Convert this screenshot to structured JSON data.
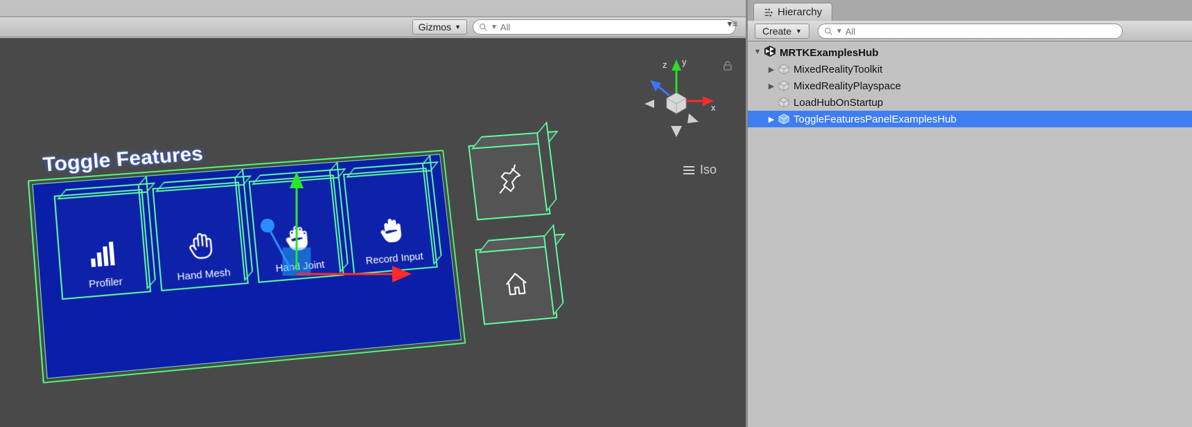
{
  "scene_toolbar": {
    "gizmos_label": "Gizmos",
    "search_placeholder": "All"
  },
  "viewport": {
    "projection_mode": "Iso",
    "axis": {
      "x": "x",
      "y": "y",
      "z": "z"
    }
  },
  "toggle_panel": {
    "title": "Toggle Features",
    "buttons": [
      {
        "label": "Profiler",
        "icon": "bars-icon"
      },
      {
        "label": "Hand Mesh",
        "icon": "hand-icon"
      },
      {
        "label": "Hand Joint",
        "icon": "hand-joint-icon"
      },
      {
        "label": "Record Input",
        "icon": "hand-record-icon"
      }
    ],
    "side_buttons": [
      {
        "icon": "pin-icon"
      },
      {
        "icon": "home-icon"
      }
    ]
  },
  "hierarchy_panel": {
    "tab_label": "Hierarchy",
    "create_label": "Create",
    "search_placeholder": "All",
    "scene_name": "MRTKExamplesHub",
    "items": [
      {
        "label": "MixedRealityToolkit",
        "has_children": true,
        "selected": false
      },
      {
        "label": "MixedRealityPlayspace",
        "has_children": true,
        "selected": false
      },
      {
        "label": "LoadHubOnStartup",
        "has_children": false,
        "selected": false
      },
      {
        "label": "ToggleFeaturesPanelExamplesHub",
        "has_children": true,
        "selected": true
      }
    ]
  }
}
